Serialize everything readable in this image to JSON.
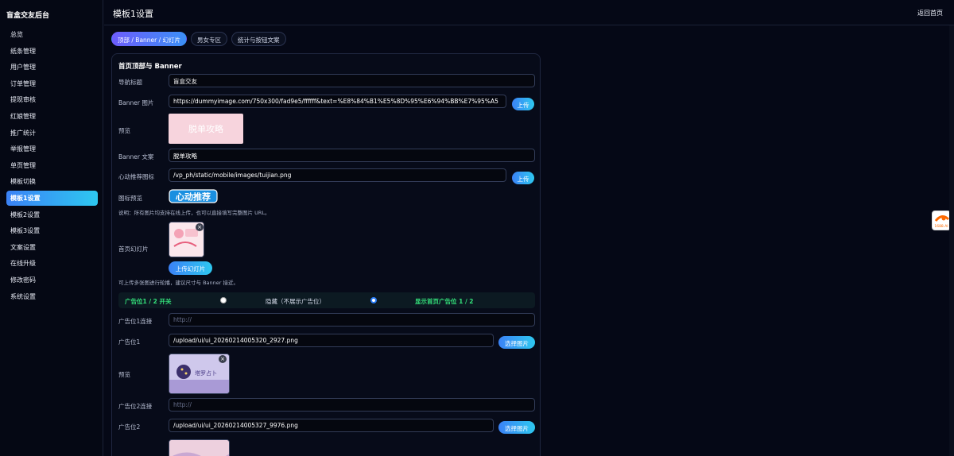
{
  "sidebar": {
    "brand": "盲盒交友后台",
    "items": [
      {
        "label": "总览"
      },
      {
        "label": "纸条管理"
      },
      {
        "label": "用户管理"
      },
      {
        "label": "订单管理"
      },
      {
        "label": "提现审核"
      },
      {
        "label": "红娘管理"
      },
      {
        "label": "推广统计"
      },
      {
        "label": "举报管理"
      },
      {
        "label": "单页管理"
      },
      {
        "label": "模板切换"
      },
      {
        "label": "模板1设置",
        "active": true
      },
      {
        "label": "模板2设置"
      },
      {
        "label": "模板3设置"
      },
      {
        "label": "文案设置"
      },
      {
        "label": "在线升级"
      },
      {
        "label": "修改密码"
      },
      {
        "label": "系统设置"
      }
    ]
  },
  "header": {
    "title": "模板1设置",
    "back_label": "返回首页"
  },
  "tabs": [
    {
      "label": "顶部 / Banner / 幻灯片",
      "active": true
    },
    {
      "label": "男女专区"
    },
    {
      "label": "统计与按钮文案"
    }
  ],
  "section": {
    "title": "首页顶部与 Banner",
    "nav_title_label": "导航标题",
    "nav_title_value": "盲盒交友",
    "banner_image_label": "Banner 图片",
    "banner_image_value": "https://dummyimage.com/750x300/fad9e5/ffffff&text=%E8%84%B1%E5%8D%95%E6%94%BB%E7%95%A5",
    "upload_label": "上传",
    "preview_label": "预览",
    "banner_preview_text": "脱单攻略",
    "banner_text_label": "Banner 文案",
    "banner_text_value": "脱单攻略",
    "recommend_icon_label": "心动推荐图标",
    "recommend_icon_value": "/vp_ph/static/mobile/images/tuijian.png",
    "icon_preview_label": "图标预览",
    "icon_preview_text": "心动推荐",
    "note1": "说明：所有图片均支持在线上传，也可以直接填写完整图片 URL。",
    "slides_label": "首页幻灯片",
    "upload_slides_label": "上传幻灯片",
    "note2": "可上传多张图进行轮播，建议尺寸与 Banner 接近。"
  },
  "ads": {
    "switch_label": "广告位1 / 2 开关",
    "option_hide": "隐藏（不展示广告位）",
    "option_show": "显示首页广告位 1 / 2",
    "selected": "show",
    "ad1_link_label": "广告位1连接",
    "ad1_link_placeholder": "http://",
    "ad1_label": "广告位1",
    "ad1_value": "/upload/ui/ui_20260214005320_2927.png",
    "choose_label": "选择图片",
    "preview_label": "预览",
    "ad1_thumb_text": "塔罗占卜",
    "ad2_link_label": "广告位2连接",
    "ad2_link_placeholder": "http://",
    "ad2_label": "广告位2",
    "ad2_value": "/upload/ui/ui_20260214005327_9976.png"
  },
  "widget": {
    "label": "1688.AI"
  },
  "colors": {
    "accent_start": "#3b82f6",
    "accent_end": "#2ec8f0",
    "background": "#050816",
    "success": "#34e07a"
  }
}
